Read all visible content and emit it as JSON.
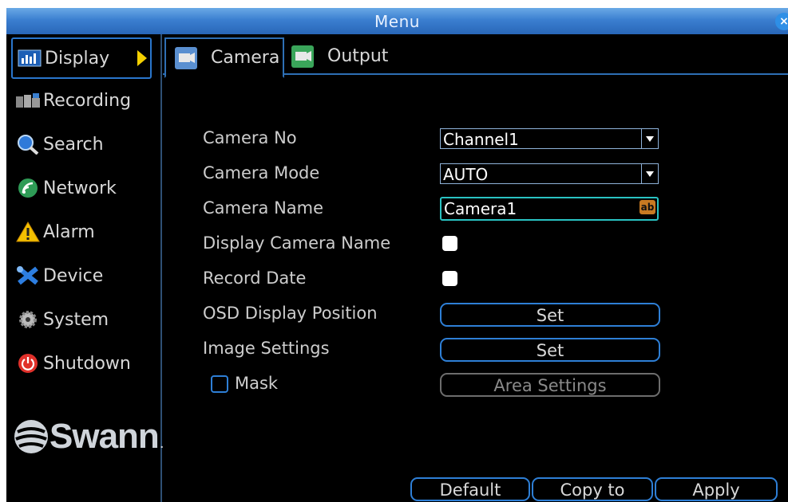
{
  "window": {
    "title": "Menu",
    "close_label": "×"
  },
  "sidebar": {
    "items": [
      {
        "label": "Display",
        "icon": "display-icon",
        "active": true
      },
      {
        "label": "Recording",
        "icon": "recording-icon"
      },
      {
        "label": "Search",
        "icon": "search-icon"
      },
      {
        "label": "Network",
        "icon": "network-icon"
      },
      {
        "label": "Alarm",
        "icon": "alarm-icon"
      },
      {
        "label": "Device",
        "icon": "device-icon"
      },
      {
        "label": "System",
        "icon": "system-icon"
      },
      {
        "label": "Shutdown",
        "icon": "shutdown-icon"
      }
    ],
    "logo": {
      "text": "Swann",
      "suffix": "."
    }
  },
  "tabs": [
    {
      "label": "Camera",
      "active": true,
      "icon": "camera-tab-icon"
    },
    {
      "label": "Output",
      "active": false,
      "icon": "output-tab-icon"
    }
  ],
  "form": {
    "camera_no": {
      "label": "Camera No",
      "value": "Channel1"
    },
    "camera_mode": {
      "label": "Camera Mode",
      "value": "AUTO"
    },
    "camera_name": {
      "label": "Camera Name",
      "value": "Camera1",
      "keyboard_icon": "ab"
    },
    "display_camera_name": {
      "label": "Display Camera Name",
      "checked": true
    },
    "record_date": {
      "label": "Record Date",
      "checked": true
    },
    "osd_position": {
      "label": "OSD Display Position",
      "button": "Set"
    },
    "image_settings": {
      "label": "Image Settings",
      "button": "Set"
    },
    "mask": {
      "label": "Mask",
      "checked": false,
      "button": "Area Settings",
      "button_disabled": true
    }
  },
  "footer": {
    "default_label": "Default",
    "copy_label": "Copy to",
    "apply_label": "Apply"
  },
  "colors": {
    "accent": "#2e7fd6",
    "titlebar": "#3b7fd0",
    "highlight": "#f4d000",
    "text_field_border": "#29c3c3"
  }
}
